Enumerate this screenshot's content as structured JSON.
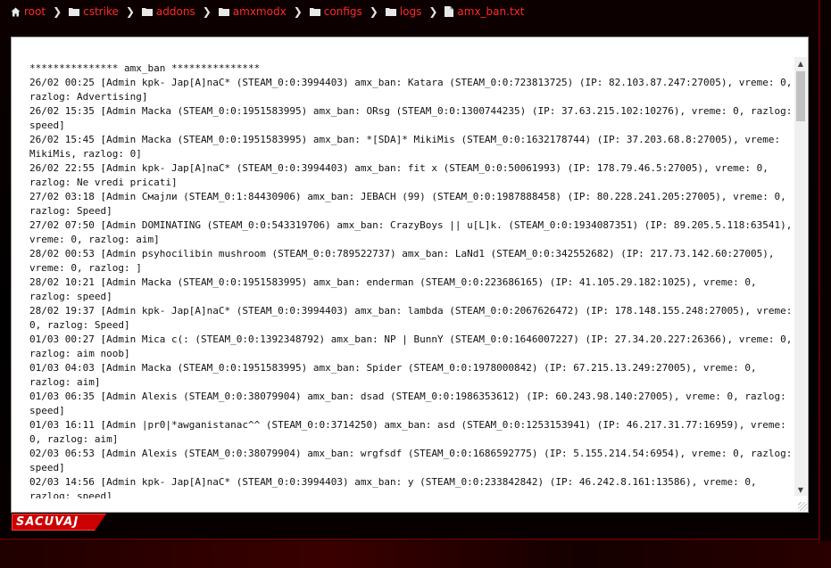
{
  "breadcrumb": {
    "items": [
      {
        "label": "root",
        "icon": "home-icon"
      },
      {
        "label": "cstrike",
        "icon": "folder-icon"
      },
      {
        "label": "addons",
        "icon": "folder-icon"
      },
      {
        "label": "amxmodx",
        "icon": "folder-icon"
      },
      {
        "label": "configs",
        "icon": "folder-icon"
      },
      {
        "label": "logs",
        "icon": "folder-icon"
      },
      {
        "label": "amx_ban.txt",
        "icon": "file-icon"
      }
    ],
    "separator": "❯"
  },
  "file": {
    "content": "*************** amx_ban ***************\n26/02 00:25 [Admin kpk- Jap[A]naC* (STEAM_0:0:3994403) amx_ban: Katara (STEAM_0:0:723813725) (IP: 82.103.87.247:27005), vreme: 0, razlog: Advertising]\n26/02 15:35 [Admin Macka (STEAM_0:0:1951583995) amx_ban: ORsg (STEAM_0:0:1300744235) (IP: 37.63.215.102:10276), vreme: 0, razlog: speed]\n26/02 15:45 [Admin Macka (STEAM_0:0:1951583995) amx_ban: *[SDA]* MikiMis (STEAM_0:0:1632178744) (IP: 37.203.68.8:27005), vreme: MikiMis, razlog: 0]\n26/02 22:55 [Admin kpk- Jap[A]naC* (STEAM_0:0:3994403) amx_ban: fit x (STEAM_0:0:50061993) (IP: 178.79.46.5:27005), vreme: 0, razlog: Ne vredi pricati]\n27/02 03:18 [Admin Смајли (STEAM_0:1:84430906) amx_ban: JEBACH (99) (STEAM_0:0:1987888458) (IP: 80.228.241.205:27005), vreme: 0, razlog: Speed]\n27/02 07:50 [Admin DOMINATING (STEAM_0:0:543319706) amx_ban: CrazyBoys || u[L]k. (STEAM_0:0:1934087351) (IP: 89.205.5.118:63541), vreme: 0, razlog: aim]\n28/02 00:53 [Admin psyhocilibin mushroom (STEAM_0:0:789522737) amx_ban: LaNd1 (STEAM_0:0:342552682) (IP: 217.73.142.60:27005), vreme: 0, razlog: ]\n28/02 10:21 [Admin Macka (STEAM_0:0:1951583995) amx_ban: enderman (STEAM_0:0:223686165) (IP: 41.105.29.182:1025), vreme: 0, razlog: speed]\n28/02 19:37 [Admin kpk- Jap[A]naC* (STEAM_0:0:3994403) amx_ban: lambda (STEAM_0:0:2067626472) (IP: 178.148.155.248:27005), vreme: 0, razlog: Speed]\n01/03 00:27 [Admin Mica c(: (STEAM_0:0:1392348792) amx_ban: NP | BunnY (STEAM_0:0:1646007227) (IP: 27.34.20.227:26366), vreme: 0, razlog: aim noob]\n01/03 04:03 [Admin Macka (STEAM_0:0:1951583995) amx_ban: Spider (STEAM_0:0:1978000842) (IP: 67.215.13.249:27005), vreme: 0, razlog: aim]\n01/03 06:35 [Admin Alexis (STEAM_0:0:38079904) amx_ban: dsad (STEAM_0:0:1986353612) (IP: 60.243.98.140:27005), vreme: 0, razlog: speed]\n01/03 16:11 [Admin |pr0|*awganistanac^^ (STEAM_0:0:3714250) amx_ban: asd (STEAM_0:0:1253153941) (IP: 46.217.31.77:16959), vreme: 0, razlog: aim]\n02/03 06:53 [Admin Alexis (STEAM_0:0:38079904) amx_ban: wrgfsdf (STEAM_0:0:1686592775) (IP: 5.155.214.54:6954), vreme: 0, razlog: speed]\n02/03 14:56 [Admin kpk- Jap[A]naC* (STEAM_0:0:3994403) amx_ban: y (STEAM_0:0:233842842) (IP: 46.242.8.161:13586), vreme: 0, razlog: speed]"
  },
  "actions": {
    "save_label": "SACUVAJ"
  },
  "colors": {
    "accent": "#ff2a2a",
    "button": "#cc0000",
    "background": "#0a0000"
  }
}
